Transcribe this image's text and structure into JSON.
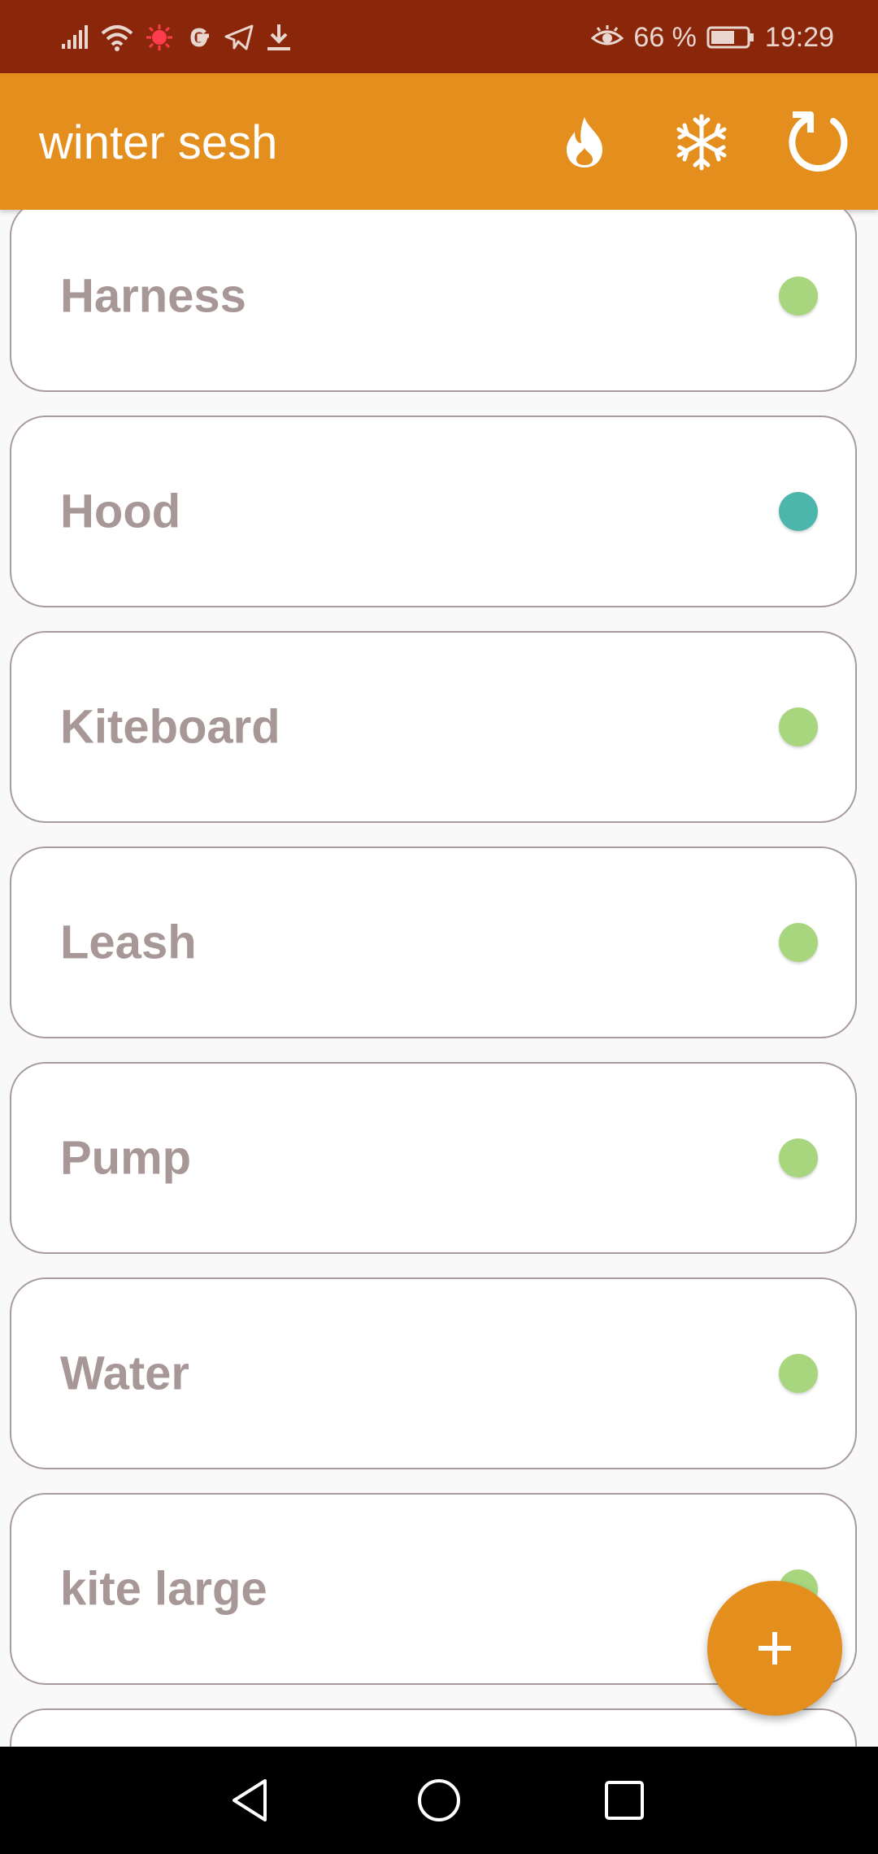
{
  "status_bar": {
    "battery_percent": "66 %",
    "battery_level": 0.66,
    "time": "19:29",
    "icons": [
      "signal-icon",
      "wifi-icon",
      "virus-icon",
      "google-icon",
      "telegram-icon",
      "download-icon",
      "eye-comfort-icon",
      "battery-icon"
    ]
  },
  "app_bar": {
    "title": "winter sesh",
    "actions": [
      "flame-icon",
      "snowflake-icon",
      "refresh-icon"
    ]
  },
  "colors": {
    "app_bar": "#e48e1e",
    "status_bar": "#8a2609",
    "dot_green": "#a8d67e",
    "dot_teal": "#4db6ac"
  },
  "items": [
    {
      "label": "Harness",
      "status": "green"
    },
    {
      "label": "Hood",
      "status": "teal"
    },
    {
      "label": "Kiteboard",
      "status": "green"
    },
    {
      "label": "Leash",
      "status": "green"
    },
    {
      "label": "Pump",
      "status": "green"
    },
    {
      "label": "Water",
      "status": "green"
    },
    {
      "label": "kite large",
      "status": "green"
    },
    {
      "label": "",
      "status": "green"
    }
  ],
  "fab": {
    "icon": "plus-icon"
  },
  "nav_bar": {
    "buttons": [
      "back-icon",
      "home-icon",
      "recents-icon"
    ]
  }
}
